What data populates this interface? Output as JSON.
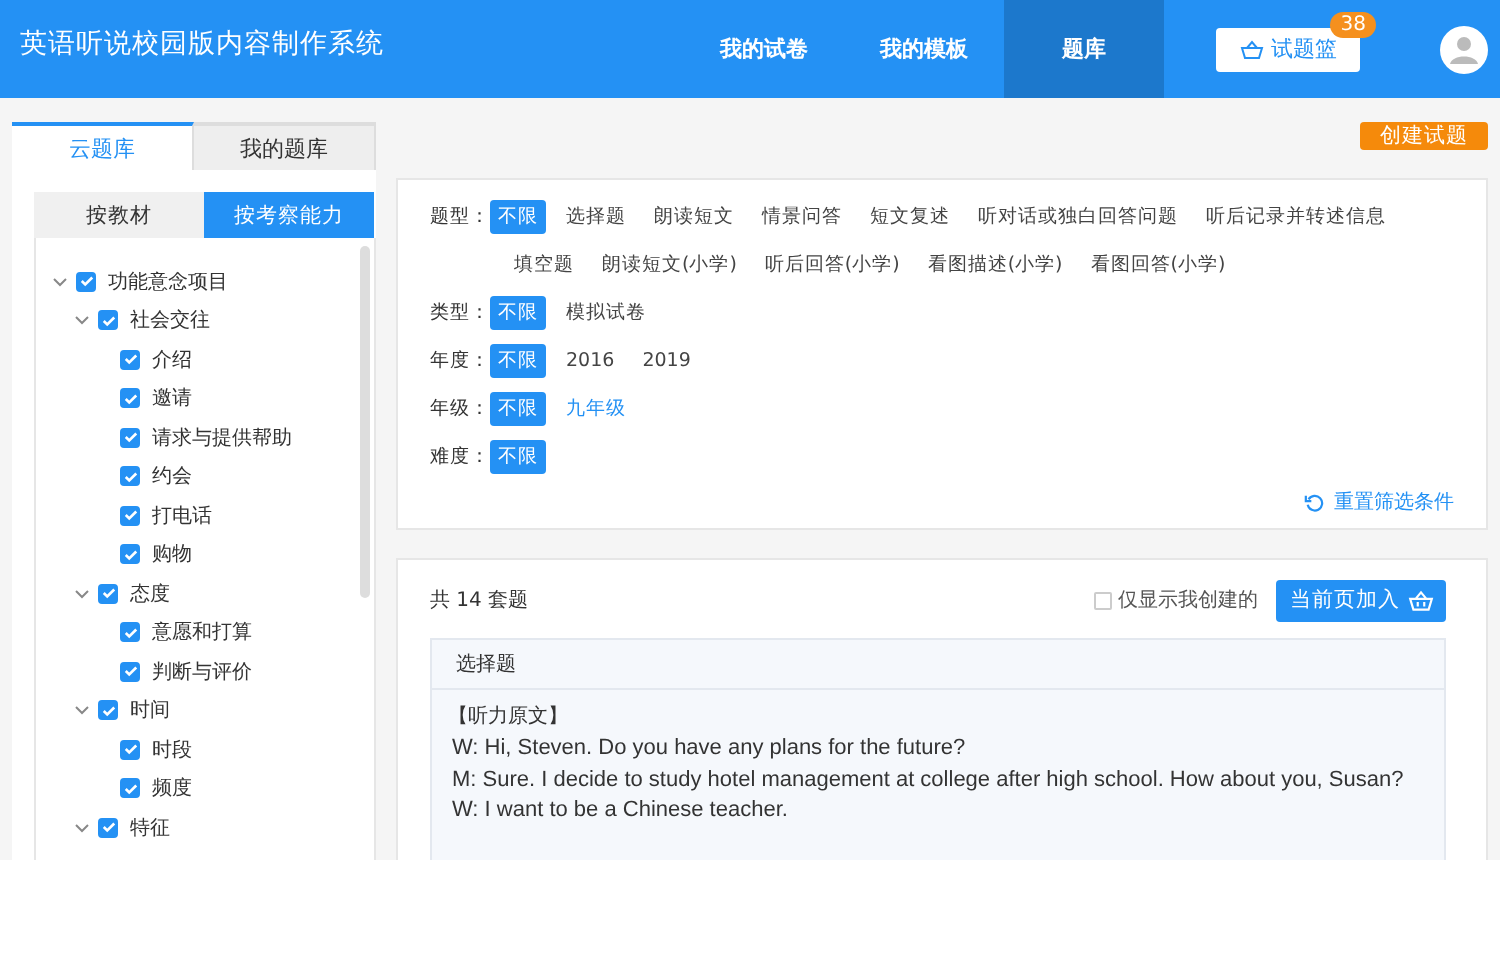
{
  "header": {
    "title": "英语听说校园版内容制作系统",
    "nav": [
      {
        "label": "我的试卷",
        "selected": false
      },
      {
        "label": "我的模板",
        "selected": false
      },
      {
        "label": "题库",
        "selected": true
      }
    ],
    "basket": {
      "label": "试题篮",
      "count": "38"
    }
  },
  "left_tabs": [
    {
      "label": "云题库",
      "selected": true
    },
    {
      "label": "我的题库",
      "selected": false
    }
  ],
  "sub_tabs": [
    {
      "label": "按教材",
      "selected": false
    },
    {
      "label": "按考察能力",
      "selected": true
    }
  ],
  "tree": [
    {
      "label": "功能意念项目",
      "checked": true,
      "expanded": true,
      "children": [
        {
          "label": "社会交往",
          "checked": true,
          "expanded": true,
          "children": [
            {
              "label": "介绍",
              "checked": true
            },
            {
              "label": "邀请",
              "checked": true
            },
            {
              "label": "请求与提供帮助",
              "checked": true
            },
            {
              "label": "约会",
              "checked": true
            },
            {
              "label": "打电话",
              "checked": true
            },
            {
              "label": "购物",
              "checked": true
            }
          ]
        },
        {
          "label": "态度",
          "checked": true,
          "expanded": true,
          "children": [
            {
              "label": "意愿和打算",
              "checked": true
            },
            {
              "label": "判断与评价",
              "checked": true
            }
          ]
        },
        {
          "label": "时间",
          "checked": true,
          "expanded": true,
          "children": [
            {
              "label": "时段",
              "checked": true
            },
            {
              "label": "频度",
              "checked": true
            }
          ]
        },
        {
          "label": "特征",
          "checked": true,
          "expanded": true
        }
      ]
    }
  ],
  "create_button": "创建试题",
  "filters": [
    {
      "label": "题型：",
      "options": [
        {
          "text": "不限",
          "selected": true
        },
        {
          "text": "选择题",
          "selected": false
        },
        {
          "text": "朗读短文",
          "selected": false
        },
        {
          "text": "情景问答",
          "selected": false
        },
        {
          "text": "短文复述",
          "selected": false
        },
        {
          "text": "听对话或独白回答问题",
          "selected": false
        },
        {
          "text": "听后记录并转述信息",
          "selected": false
        },
        {
          "text": "填空题",
          "selected": false
        },
        {
          "text": "朗读短文(小学)",
          "selected": false
        },
        {
          "text": "听后回答(小学)",
          "selected": false
        },
        {
          "text": "看图描述(小学)",
          "selected": false
        },
        {
          "text": "看图回答(小学)",
          "selected": false
        }
      ]
    },
    {
      "label": "类型：",
      "options": [
        {
          "text": "不限",
          "selected": true
        },
        {
          "text": "模拟试卷",
          "selected": false
        }
      ]
    },
    {
      "label": "年度：",
      "options": [
        {
          "text": "不限",
          "selected": true
        },
        {
          "text": "2016",
          "selected": false
        },
        {
          "text": "2019",
          "selected": false
        }
      ]
    },
    {
      "label": "年级：",
      "options": [
        {
          "text": "不限",
          "selected": true,
          "highlighted": false
        },
        {
          "text": "九年级",
          "selected": false,
          "highlighted": true
        }
      ]
    },
    {
      "label": "难度：",
      "options": [
        {
          "text": "不限",
          "selected": true
        }
      ]
    }
  ],
  "reset_link": "重置筛选条件",
  "results": {
    "count": "共 14 套题",
    "only_mine": {
      "label": "仅显示我创建的",
      "checked": false
    },
    "add_page_button": "当前页加入",
    "card": {
      "type": "选择题",
      "heading": "【听力原文】",
      "lines": [
        "W: Hi, Steven. Do you have any plans for the future?",
        "M: Sure. I decide to study hotel management at college after high school. How about you, Susan?",
        "W: I want to be a Chinese teacher."
      ]
    }
  }
}
